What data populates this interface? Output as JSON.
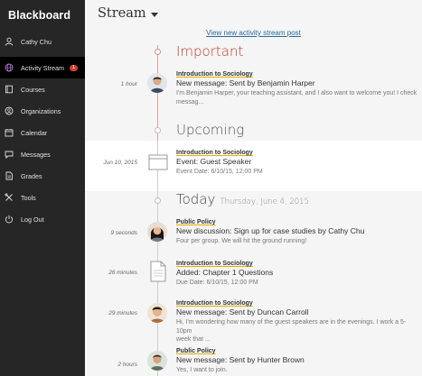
{
  "sidebar": {
    "logo": "Blackboard",
    "items": [
      {
        "label": "Cathy Chu",
        "icon": "person-icon"
      },
      {
        "label": "Activity Stream",
        "icon": "globe-icon",
        "badge": "1",
        "active": true
      },
      {
        "label": "Courses",
        "icon": "courses-icon"
      },
      {
        "label": "Organizations",
        "icon": "organizations-icon"
      },
      {
        "label": "Calendar",
        "icon": "calendar-icon"
      },
      {
        "label": "Messages",
        "icon": "messages-icon"
      },
      {
        "label": "Grades",
        "icon": "grades-icon"
      },
      {
        "label": "Tools",
        "icon": "tools-icon"
      },
      {
        "label": "Log Out",
        "icon": "power-icon"
      }
    ]
  },
  "header": {
    "title": "Stream"
  },
  "view_link": "View new activity stream post",
  "sections": {
    "important": {
      "title": "Important",
      "color": "#c0392b",
      "items": [
        {
          "time": "1 hour",
          "course": "Introduction to Sociology",
          "title": "New message: Sent by Benjamin Harper",
          "text_line1": "I'm Benjamin Harper, your teaching assistant, and I also want to welcome you! I check",
          "text_line2": "messag..."
        }
      ]
    },
    "upcoming": {
      "title": "Upcoming",
      "items": [
        {
          "time": "Jun 10, 2015",
          "course": "Introduction to Sociology",
          "title": "Event: Guest Speaker",
          "text_line1": "Event Date: 6/10/15, 12:00 PM"
        }
      ]
    },
    "today": {
      "title": "Today",
      "date": "Thursday, June 4, 2015",
      "items": [
        {
          "time": "9 seconds",
          "course": "Public Policy",
          "title": "New discussion: Sign up for case studies by Cathy Chu",
          "text_line1": "Four per group. We will hit the ground running!"
        },
        {
          "time": "26 minutes",
          "course": "Introduction to Sociology",
          "title": "Added: Chapter 1 Questions",
          "text_line1": "Due Date: 6/10/15, 12:00 PM"
        },
        {
          "time": "29 minutes",
          "course": "Introduction to Sociology",
          "title": "New message: Sent by Duncan Carroll",
          "text_line1": "Hi, I'm wondering how many of the guest speakers are in the evenings. I work a 5-10pm",
          "text_line2": "week that ..."
        },
        {
          "time": "2 hours",
          "course": "Public Policy",
          "title": "New message: Sent by Hunter Brown",
          "text_line1": "Yes, I want to join."
        }
      ]
    }
  }
}
